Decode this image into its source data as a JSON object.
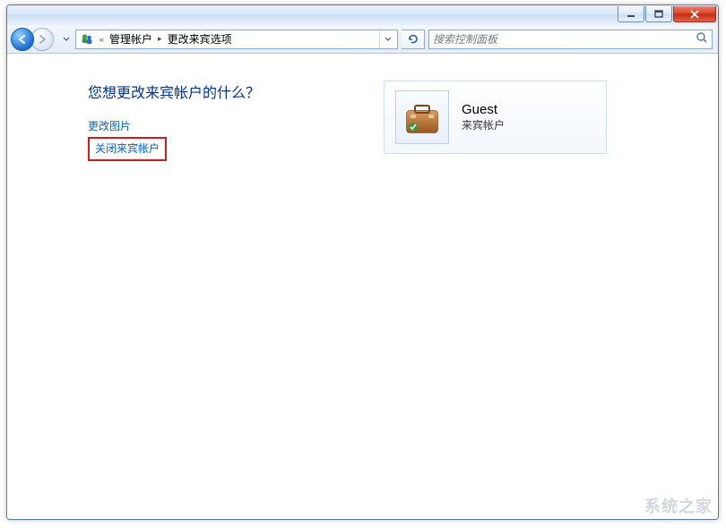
{
  "titlebar": {
    "minimize_icon": "minimize-icon",
    "maximize_icon": "maximize-icon",
    "close_icon": "close-icon"
  },
  "breadcrumb": {
    "prefix": "«",
    "segments": [
      "管理帐户",
      "更改来宾选项"
    ]
  },
  "search": {
    "placeholder": "搜索控制面板"
  },
  "page": {
    "heading": "您想更改来宾帐户的什么？",
    "link_change_picture": "更改图片",
    "link_disable_guest": "关闭来宾帐户"
  },
  "account_card": {
    "name": "Guest",
    "type": "来宾帐户"
  },
  "watermark": "系统之家"
}
